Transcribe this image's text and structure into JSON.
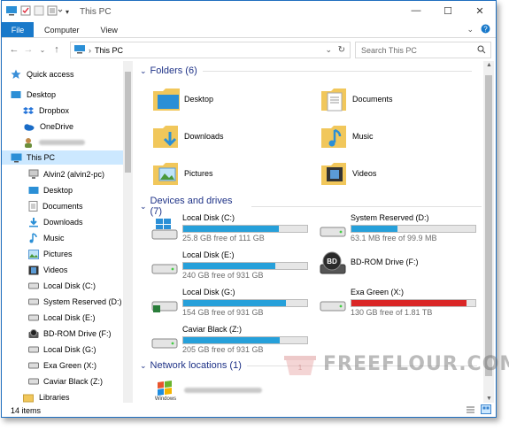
{
  "window": {
    "title": "This PC"
  },
  "ribbon": {
    "file": "File",
    "tabs": [
      "Computer",
      "View"
    ]
  },
  "address": {
    "path": "This PC"
  },
  "search": {
    "placeholder": "Search This PC"
  },
  "sidebar": {
    "items": [
      {
        "label": "Quick access",
        "icon": "star-icon"
      },
      {
        "label": "Desktop",
        "icon": "desktop-icon"
      },
      {
        "label": "Dropbox",
        "icon": "dropbox-icon"
      },
      {
        "label": "OneDrive",
        "icon": "onedrive-icon"
      },
      {
        "label": "",
        "icon": "user-icon"
      },
      {
        "label": "This PC",
        "icon": "this-pc-icon"
      },
      {
        "label": "Alvin2 (alvin2-pc)",
        "icon": "network-pc-icon"
      },
      {
        "label": "Desktop",
        "icon": "desktop-icon"
      },
      {
        "label": "Documents",
        "icon": "documents-icon"
      },
      {
        "label": "Downloads",
        "icon": "downloads-icon"
      },
      {
        "label": "Music",
        "icon": "music-icon"
      },
      {
        "label": "Pictures",
        "icon": "pictures-icon"
      },
      {
        "label": "Videos",
        "icon": "videos-icon"
      },
      {
        "label": "Local Disk (C:)",
        "icon": "drive-icon"
      },
      {
        "label": "System Reserved (D:)",
        "icon": "drive-icon"
      },
      {
        "label": "Local Disk (E:)",
        "icon": "drive-icon"
      },
      {
        "label": "BD-ROM Drive (F:)",
        "icon": "bd-drive-icon"
      },
      {
        "label": "Local Disk (G:)",
        "icon": "drive-icon"
      },
      {
        "label": "Exa Green (X:)",
        "icon": "drive-icon"
      },
      {
        "label": "Caviar Black (Z:)",
        "icon": "drive-icon"
      },
      {
        "label": "Libraries",
        "icon": "libraries-icon"
      }
    ]
  },
  "folders": {
    "heading": "Folders (6)",
    "items": [
      {
        "label": "Desktop",
        "icon": "desktop-folder-icon"
      },
      {
        "label": "Documents",
        "icon": "documents-folder-icon"
      },
      {
        "label": "Downloads",
        "icon": "downloads-folder-icon"
      },
      {
        "label": "Music",
        "icon": "music-folder-icon"
      },
      {
        "label": "Pictures",
        "icon": "pictures-folder-icon"
      },
      {
        "label": "Videos",
        "icon": "videos-folder-icon"
      }
    ]
  },
  "drives": {
    "heading": "Devices and drives (7)",
    "items": [
      {
        "name": "Local Disk (C:)",
        "free": "25.8 GB free of 111 GB",
        "used_fraction": 0.77,
        "color": "#26a0da",
        "icon": "windows-drive-icon"
      },
      {
        "name": "System Reserved (D:)",
        "free": "63.1 MB free of 99.9 MB",
        "used_fraction": 0.37,
        "color": "#26a0da",
        "icon": "drive-icon"
      },
      {
        "name": "Local Disk (E:)",
        "free": "240 GB free of 931 GB",
        "used_fraction": 0.74,
        "color": "#26a0da",
        "icon": "drive-icon"
      },
      {
        "name": "BD-ROM Drive (F:)",
        "free": "",
        "used_fraction": null,
        "color": "",
        "icon": "bd-drive-icon"
      },
      {
        "name": "Local Disk (G:)",
        "free": "154 GB free of 931 GB",
        "used_fraction": 0.83,
        "color": "#26a0da",
        "icon": "drive-icon"
      },
      {
        "name": "Exa Green (X:)",
        "free": "130 GB free of 1.81 TB",
        "used_fraction": 0.93,
        "color": "#da2626",
        "icon": "drive-icon"
      },
      {
        "name": "Caviar Black (Z:)",
        "free": "205 GB free of 931 GB",
        "used_fraction": 0.78,
        "color": "#26a0da",
        "icon": "drive-icon"
      }
    ]
  },
  "network": {
    "heading": "Network locations (1)",
    "item_label": ""
  },
  "status": {
    "items": "14 items"
  },
  "watermark": {
    "text": "FREEFLOUR.COM"
  }
}
